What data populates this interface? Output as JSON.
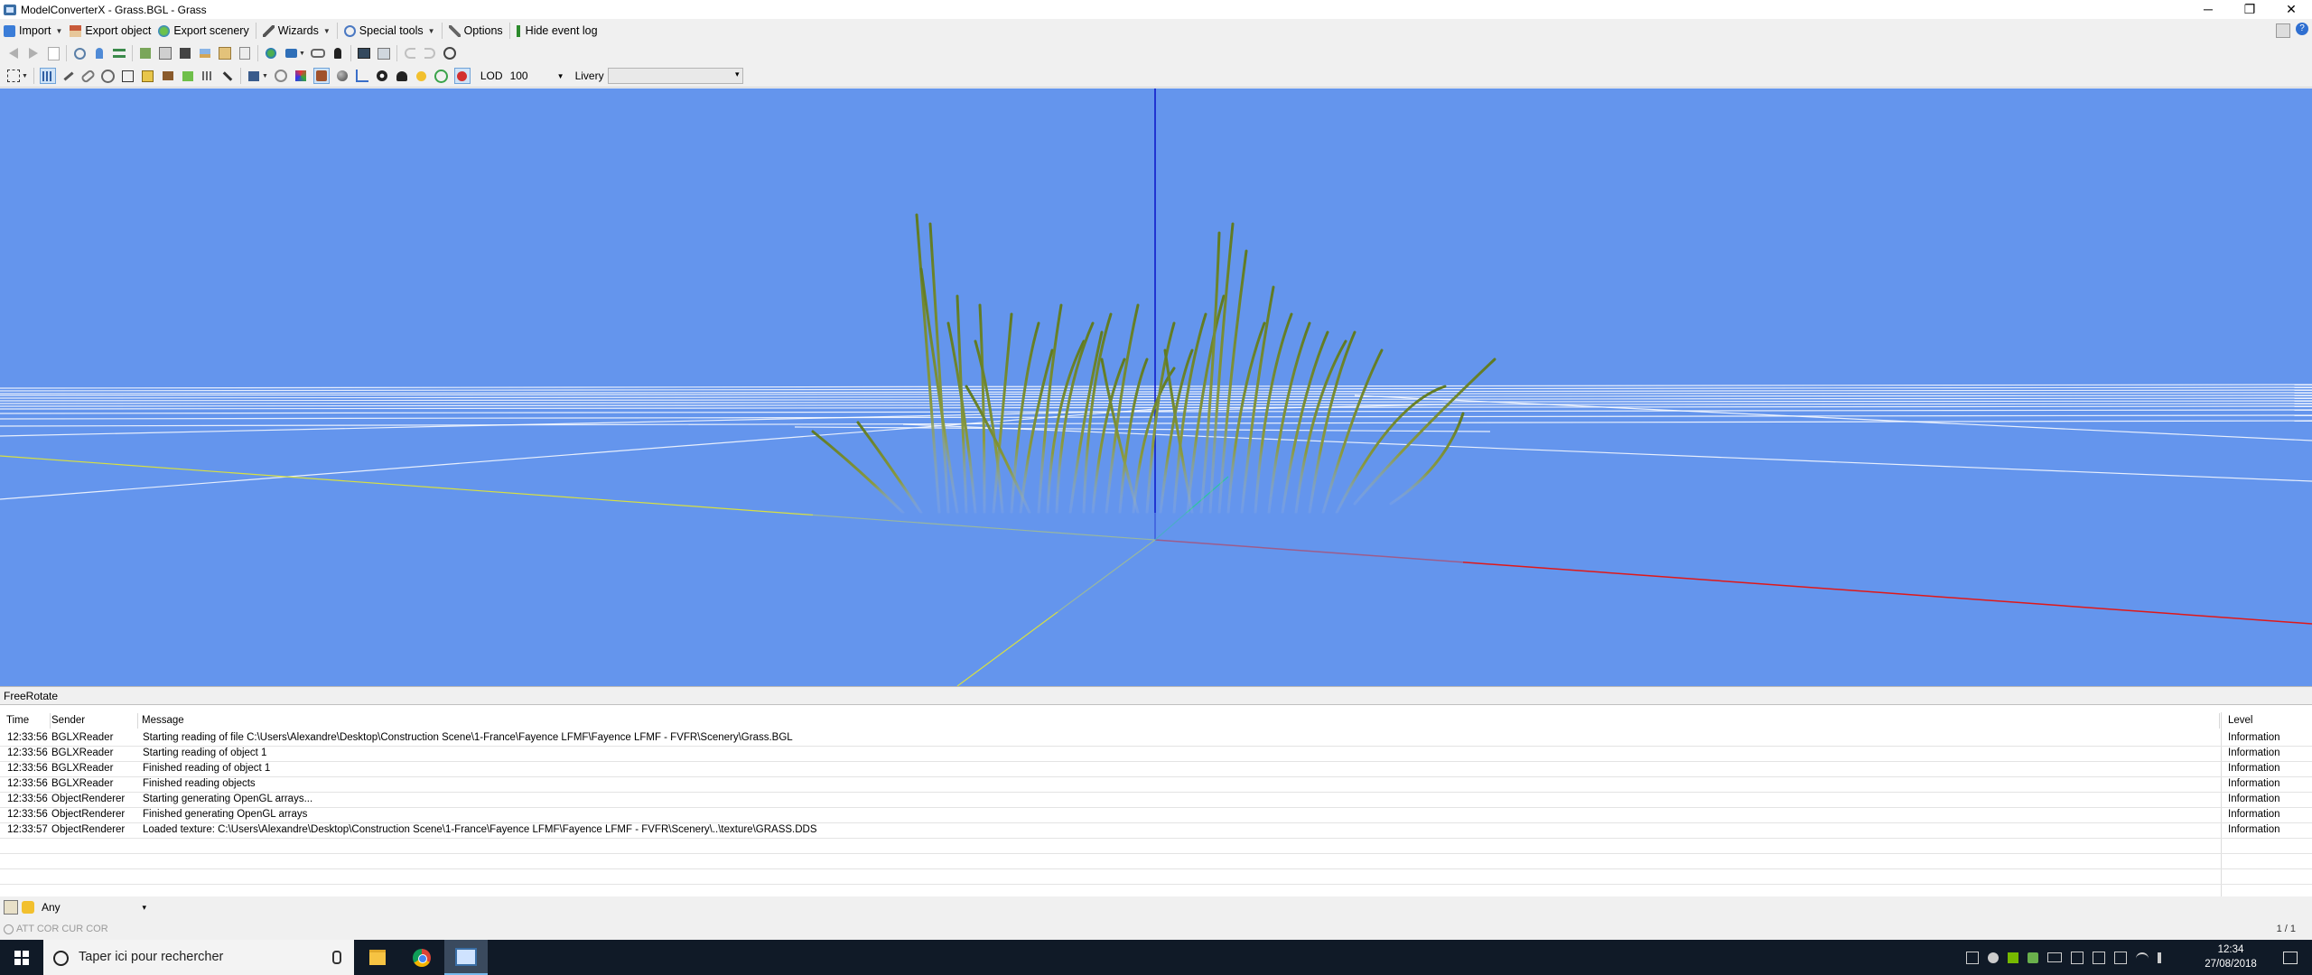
{
  "window": {
    "title": "ModelConverterX - Grass.BGL - Grass",
    "minimize_glyph": "─",
    "restore_glyph": "❐",
    "close_glyph": "✕"
  },
  "menubar": {
    "import": "Import",
    "export_object": "Export object",
    "export_scenery": "Export scenery",
    "wizards": "Wizards",
    "special_tools": "Special tools",
    "options": "Options",
    "hide_event_log": "Hide event log"
  },
  "toolbar2": {
    "lod_label": "LOD",
    "lod_value": "100",
    "livery_label": "Livery",
    "livery_value": ""
  },
  "viewport": {
    "background": "#6495ed",
    "mode": "FreeRotate"
  },
  "eventlog": {
    "columns": {
      "time": "Time",
      "sender": "Sender",
      "message": "Message",
      "level": "Level"
    },
    "rows": [
      {
        "time": "12:33:56",
        "sender": "BGLXReader",
        "message": "Starting reading of file C:\\Users\\Alexandre\\Desktop\\Construction Scene\\1-France\\Fayence LFMF\\Fayence LFMF - FVFR\\Scenery\\Grass.BGL",
        "level": "Information"
      },
      {
        "time": "12:33:56",
        "sender": "BGLXReader",
        "message": "Starting reading of object 1",
        "level": "Information"
      },
      {
        "time": "12:33:56",
        "sender": "BGLXReader",
        "message": "Finished reading of object 1",
        "level": "Information"
      },
      {
        "time": "12:33:56",
        "sender": "BGLXReader",
        "message": "Finished reading objects",
        "level": "Information"
      },
      {
        "time": "12:33:56",
        "sender": "ObjectRenderer",
        "message": "Starting generating OpenGL arrays...",
        "level": "Information"
      },
      {
        "time": "12:33:56",
        "sender": "ObjectRenderer",
        "message": "Finished generating OpenGL arrays",
        "level": "Information"
      },
      {
        "time": "12:33:57",
        "sender": "ObjectRenderer",
        "message": "Loaded texture: C:\\Users\\Alexandre\\Desktop\\Construction Scene\\1-France\\Fayence LFMF\\Fayence LFMF - FVFR\\Scenery\\..\\texture\\GRASS.DDS",
        "level": "Information"
      }
    ],
    "filter_value": "Any",
    "coords": "ATT COR  CUR COR",
    "page": "1 / 1"
  },
  "taskbar": {
    "search_placeholder": "Taper ici pour rechercher",
    "time": "12:34",
    "date": "27/08/2018",
    "bg": "#101a27"
  }
}
